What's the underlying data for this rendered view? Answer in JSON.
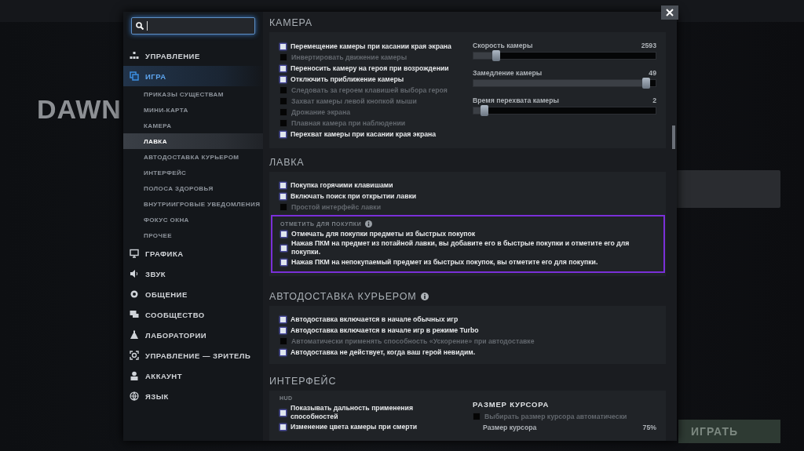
{
  "background": {
    "hero_name": "DAWN",
    "play_button": "ИГРАТЬ"
  },
  "sidebar": {
    "items": [
      {
        "label": "УПРАВЛЕНИЕ",
        "selected": false
      },
      {
        "label": "ИГРА",
        "selected": true,
        "children": [
          {
            "label": "ПРИКАЗЫ СУЩЕСТВАМ",
            "selected": false
          },
          {
            "label": "МИНИ-КАРТА",
            "selected": false
          },
          {
            "label": "КАМЕРА",
            "selected": false
          },
          {
            "label": "ЛАВКА",
            "selected": true
          },
          {
            "label": "АВТОДОСТАВКА КУРЬЕРОМ",
            "selected": false
          },
          {
            "label": "ИНТЕРФЕЙС",
            "selected": false
          },
          {
            "label": "ПОЛОСА ЗДОРОВЬЯ",
            "selected": false
          },
          {
            "label": "ВНУТРИИГРОВЫЕ УВЕДОМЛЕНИЯ",
            "selected": false
          },
          {
            "label": "ФОКУС ОКНА",
            "selected": false
          },
          {
            "label": "ПРОЧЕЕ",
            "selected": false
          }
        ]
      },
      {
        "label": "ГРАФИКА",
        "selected": false
      },
      {
        "label": "ЗВУК",
        "selected": false
      },
      {
        "label": "ОБЩЕНИЕ",
        "selected": false
      },
      {
        "label": "СООБЩЕСТВО",
        "selected": false
      },
      {
        "label": "ЛАБОРАТОРИИ",
        "selected": false
      },
      {
        "label": "УПРАВЛЕНИЕ — ЗРИТЕЛЬ",
        "selected": false
      },
      {
        "label": "АККАУНТ",
        "selected": false
      },
      {
        "label": "ЯЗЫК",
        "selected": false
      }
    ]
  },
  "camera": {
    "title": "КАМЕРА",
    "checkboxes": [
      {
        "label": "Перемещение камеры при касании края экрана",
        "checked": true
      },
      {
        "label": "Инвертировать движение камеры",
        "checked": false
      },
      {
        "label": "Переносить камеру на героя при возрождении",
        "checked": true
      },
      {
        "label": "Отключить приближение камеры",
        "checked": true
      },
      {
        "label": "Следовать за героем клавишей выбора героя",
        "checked": false
      },
      {
        "label": "Захват камеры левой кнопкой мыши",
        "checked": false
      },
      {
        "label": "Дрожание экрана",
        "checked": false
      },
      {
        "label": "Плавная камера при наблюдении",
        "checked": false
      },
      {
        "label": "Перехват камеры при касании края экрана",
        "checked": true
      }
    ],
    "sliders": [
      {
        "label": "Скорость камеры",
        "reading": "2593",
        "level": 0.11
      },
      {
        "label": "Замедление камеры",
        "reading": "49",
        "level": 0.97
      },
      {
        "label": "Время перехвата камеры",
        "reading": "2",
        "level": 0.04
      }
    ]
  },
  "shop": {
    "title": "ЛАВКА",
    "checkboxes": [
      {
        "label": "Покупка горячими клавишами",
        "checked": true
      },
      {
        "label": "Включать поиск при открытии лавки",
        "checked": true
      },
      {
        "label": "Простой интерфейс лавки",
        "checked": false
      }
    ],
    "group": {
      "title": "ОТМЕТИТЬ ДЛЯ ПОКУПКИ",
      "info": true,
      "highlighted": true,
      "checkboxes": [
        {
          "label": "Отмечать для покупки предметы из быстрых покупок",
          "checked": true
        },
        {
          "label": "Нажав ПКМ на предмет из потайной лавки, вы добавите его в быстрые покупки и отметите его для покупки.",
          "checked": true
        },
        {
          "label": "Нажав ПКМ на непокупаемый предмет из быстрых покупок, вы отметите его для покупки.",
          "checked": true
        }
      ]
    }
  },
  "courier": {
    "title": "АВТОДОСТАВКА КУРЬЕРОМ",
    "info": true,
    "checkboxes": [
      {
        "label": "Автодоставка включается в начале обычных игр",
        "checked": true
      },
      {
        "label": "Автодоставка включается в начале игр в режиме Turbo",
        "checked": true
      },
      {
        "label": "Автоматически применять способность «Ускорение» при автодоставке",
        "checked": false
      },
      {
        "label": "Автодоставка не действует, когда ваш герой невидим.",
        "checked": true
      }
    ]
  },
  "interface": {
    "title": "ИНТЕРФЕЙС",
    "hud": {
      "title": "HUD",
      "checkboxes": [
        {
          "label": "Показывать дальность применения способностей",
          "checked": true
        },
        {
          "label": "Изменение цвета камеры при смерти",
          "checked": true
        }
      ]
    },
    "cursor": {
      "title": "РАЗМЕР КУРСОРА",
      "checkboxes": [
        {
          "label": "Выбирать размер курсора автоматически",
          "checked": false
        }
      ],
      "size_label": "Размер курсора",
      "size_reading": "75%"
    }
  }
}
